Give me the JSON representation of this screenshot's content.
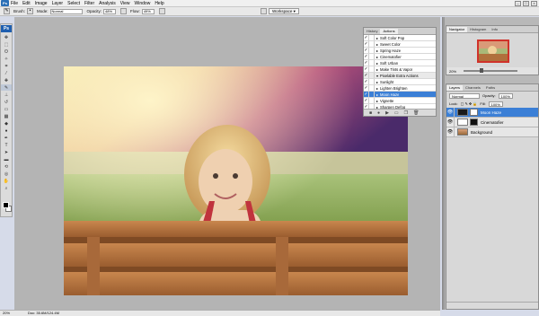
{
  "app": {
    "logo": "Ps"
  },
  "menubar": {
    "items": [
      "File",
      "Edit",
      "Image",
      "Layer",
      "Select",
      "Filter",
      "Analysis",
      "View",
      "Window",
      "Help"
    ]
  },
  "options": {
    "brush_label": "Brush:",
    "mode_label": "Mode:",
    "mode_value": "Normal",
    "opacity_label": "Opacity:",
    "opacity_value": "48%",
    "flow_label": "Flow:",
    "flow_value": "49%",
    "workspace_label": "Workspace ▾"
  },
  "actions_panel": {
    "tabs": [
      "History",
      "Actions"
    ],
    "rows": [
      {
        "label": "Soft Color Pop",
        "type": "action"
      },
      {
        "label": "Sweet Color",
        "type": "action"
      },
      {
        "label": "Spring Haze",
        "type": "action"
      },
      {
        "label": "Cinematofier",
        "type": "action"
      },
      {
        "label": "Soft Urban",
        "type": "action"
      },
      {
        "label": "Make Tints & Vapor",
        "type": "action"
      },
      {
        "label": "Pixelable Extra Actions",
        "type": "set"
      },
      {
        "label": "Sunlight",
        "type": "action"
      },
      {
        "label": "Lighten Brighten",
        "type": "action"
      },
      {
        "label": "Moon Haze",
        "type": "action",
        "selected": true
      },
      {
        "label": "Vignette",
        "type": "action"
      },
      {
        "label": "Sharpen Defog",
        "type": "action"
      }
    ]
  },
  "navigator": {
    "tabs": [
      "Navigator",
      "Histogram",
      "Info"
    ],
    "zoom": "20%"
  },
  "layers_panel": {
    "tabs": [
      "Layers",
      "Channels",
      "Paths"
    ],
    "blend_mode": "Normal",
    "opacity_label": "Opacity:",
    "opacity_value": "100%",
    "lock_label": "Lock:",
    "fill_label": "Fill:",
    "fill_value": "100%",
    "layers": [
      {
        "name": "Moon Haze",
        "selected": true
      },
      {
        "name": "Cinematofier",
        "selected": false
      },
      {
        "name": "Background",
        "selected": false
      }
    ]
  },
  "status": {
    "zoom": "20%",
    "doc": "Doc: 35.6M/124.4M"
  }
}
